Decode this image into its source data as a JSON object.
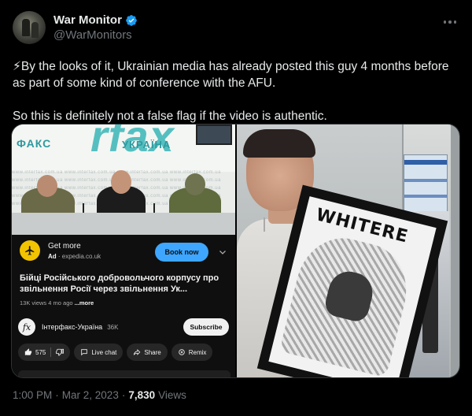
{
  "author": {
    "display_name": "War Monitor",
    "handle": "@WarMonitors",
    "verified_color": "#1d9bf0"
  },
  "tweet": {
    "text": "⚡By the looks of it, Ukrainian media has already posted this guy 4 months before as part of some kind of conference with the AFU.\n\nSo this is definitely not a false flag if the video is authentic."
  },
  "media_left": {
    "brand_left": "ФАКС",
    "brand_big": "rfax",
    "brand_right": "УКРАЇНА",
    "watermark_text": "www.interfax.com.ua   www.interfax.com.ua   www.interfax.com.ua   www.interfax.com.ua",
    "ad": {
      "title": "Get more",
      "badge": "Ad",
      "domain": "expedia.co.uk",
      "button": "Book now"
    },
    "video_title": "Бійці Російського добровольчого корпусу про звільнення Росії через звільнення Ук...",
    "meta": "13K views  4 mo ago ",
    "meta_more": "...more",
    "channel": {
      "logo": "fx",
      "name": "Інтерфакс-Україна",
      "subs": "36K",
      "subscribe": "Subscribe"
    },
    "actions": {
      "likes": "575",
      "live_chat": "Live chat",
      "share": "Share",
      "remix": "Remix"
    }
  },
  "media_right": {
    "frame_word": "WHITERE"
  },
  "footer": {
    "time": "1:00 PM",
    "dot": "·",
    "date": "Mar 2, 2023",
    "dot2": "·",
    "views": "7,830",
    "views_label": "Views"
  },
  "colors": {
    "background": "#000000",
    "text_primary": "#e7e9ea",
    "text_secondary": "#71767b",
    "accent": "#1d9bf0"
  }
}
